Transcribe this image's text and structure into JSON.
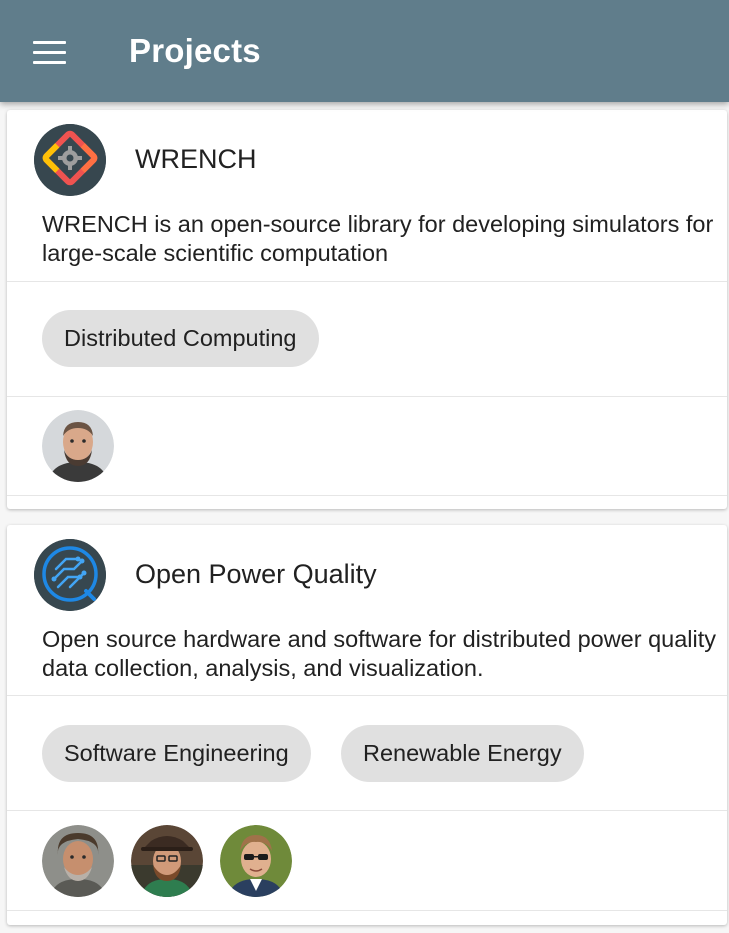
{
  "appbar": {
    "title": "Projects",
    "menu_icon": "hamburger-menu-icon",
    "color": "#607d8b"
  },
  "projects": [
    {
      "name": "WRENCH",
      "logo_icon": "wrench-gear-logo",
      "description": "WRENCH is an open-source library for developing simulators for large-scale scientific computation",
      "interests": [
        "Distributed Computing"
      ],
      "participants": [
        "participant-avatar"
      ]
    },
    {
      "name": "Open Power Quality",
      "logo_icon": "open-power-quality-logo",
      "description": "Open source hardware and software for distributed power quality data collection, analysis, and visualization.",
      "interests": [
        "Software Engineering",
        "Renewable Energy"
      ],
      "participants": [
        "participant-avatar",
        "participant-avatar",
        "participant-avatar"
      ]
    }
  ],
  "colors": {
    "chip_bg": "#e0e0e0",
    "card_bg": "#ffffff",
    "page_bg": "#f6f6f6"
  }
}
